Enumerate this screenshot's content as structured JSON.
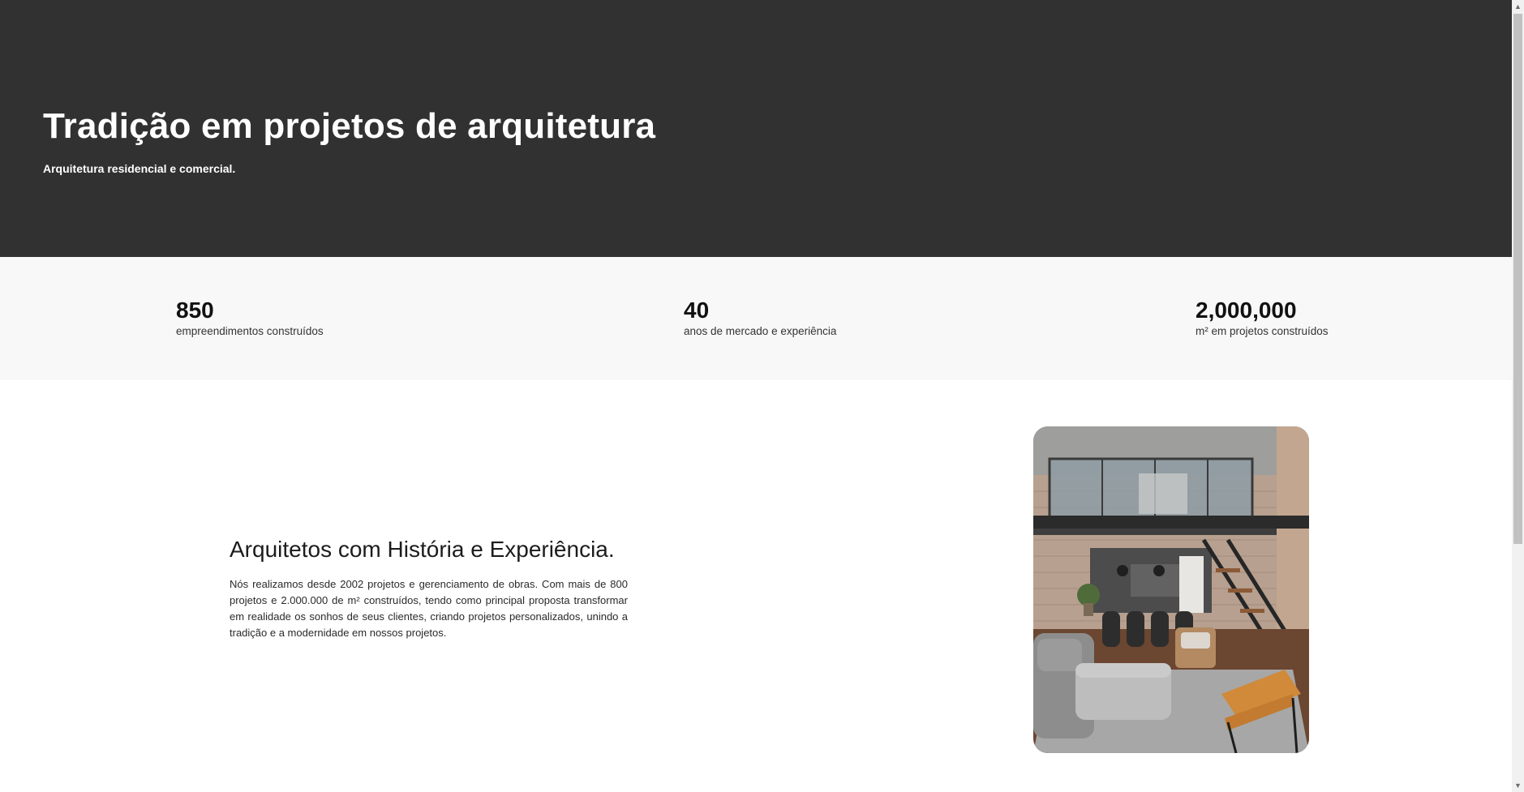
{
  "hero": {
    "title": "Tradição em projetos de arquitetura",
    "subtitle": "Arquitetura residencial e comercial."
  },
  "stats": [
    {
      "value": "850",
      "label": "empreendimentos construídos"
    },
    {
      "value": "40",
      "label": "anos de mercado e experiência"
    },
    {
      "value": "2,000,000",
      "label": "m² em projetos construídos"
    }
  ],
  "about": {
    "title": "Arquitetos com História e Experiência.",
    "text": "Nós realizamos desde 2002 projetos e gerenciamento de obras. Com mais de 800 projetos e 2.000.000 de m² construídos, tendo como principal proposta transformar em realidade os sonhos de seus clientes, criando projetos personalizados, unindo a tradição e a modernidade em nossos projetos."
  },
  "icons": {
    "scroll_up": "chevron-up-icon",
    "scroll_down": "chevron-down-icon"
  },
  "colors": {
    "hero_bg": "#313131",
    "stats_bg": "#f8f8f8",
    "text_dark": "#111111",
    "text_light": "#ffffff"
  }
}
